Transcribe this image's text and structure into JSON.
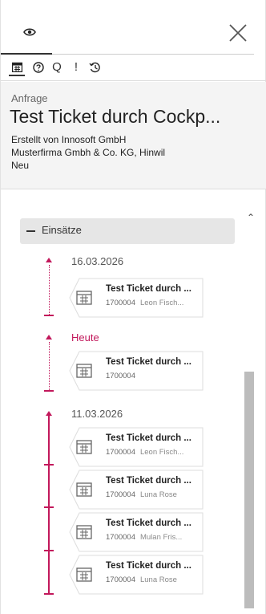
{
  "header": {
    "eye_tab_icon": "eye-icon",
    "close_icon": "close-icon"
  },
  "toolbar": {
    "icons": [
      "calendar-icon",
      "help-circle-icon",
      "search-icon",
      "exclamation-icon",
      "history-icon"
    ],
    "q_glyph": "Q",
    "excl_glyph": "!"
  },
  "info": {
    "type": "Anfrage",
    "title": "Test Ticket durch Cockp...",
    "created_by": "Erstellt von Innosoft GmbH",
    "company": "Musterfirma Gmbh & Co. KG, Hinwil",
    "status": "Neu"
  },
  "section": {
    "label": "Einsätze"
  },
  "groups": [
    {
      "date": "16.03.2026",
      "items": [
        {
          "title": "Test Ticket durch ...",
          "number": "1700004",
          "person": "Leon Fisch..."
        }
      ]
    },
    {
      "date": "Heute",
      "items": [
        {
          "title": "Test Ticket durch ...",
          "number": "1700004",
          "person": ""
        }
      ]
    },
    {
      "date": "11.03.2026",
      "items": [
        {
          "title": "Test Ticket durch ...",
          "number": "1700004",
          "person": "Leon Fisch..."
        },
        {
          "title": "Test Ticket durch ...",
          "number": "1700004",
          "person": "Luna Rose"
        },
        {
          "title": "Test Ticket durch ...",
          "number": "1700004",
          "person": "Mulan Fris..."
        },
        {
          "title": "Test Ticket durch ...",
          "number": "1700004",
          "person": "Luna Rose"
        }
      ]
    }
  ],
  "colors": {
    "accent": "#c2185b",
    "info_bg": "#f4f4f4",
    "section_bg": "#e6e6e6"
  }
}
